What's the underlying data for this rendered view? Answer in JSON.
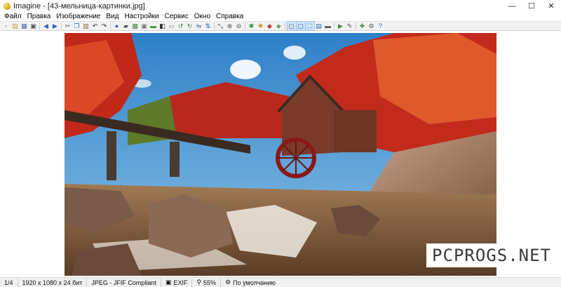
{
  "window": {
    "title": "Imagine - [43-мельница-картинки.jpg]",
    "minimize": "—",
    "maximize": "☐",
    "close": "✕"
  },
  "menu": {
    "items": [
      "Файл",
      "Правка",
      "Изображение",
      "Вид",
      "Настройки",
      "Сервис",
      "Окно",
      "Справка"
    ]
  },
  "toolbar": {
    "buttons": [
      {
        "icon": "new-icon",
        "glyph": "▫",
        "color": "#6a7fa8"
      },
      {
        "icon": "open-icon",
        "glyph": "▤",
        "color": "#c89a2a"
      },
      {
        "icon": "save-icon",
        "glyph": "▦",
        "color": "#4a6ea8"
      },
      {
        "icon": "print-icon",
        "glyph": "▣",
        "color": "#555555"
      },
      {
        "icon": "back-icon",
        "glyph": "◀",
        "color": "#2f62b8"
      },
      {
        "icon": "forward-icon",
        "glyph": "▶",
        "color": "#2f62b8"
      },
      {
        "icon": "cut-icon",
        "glyph": "✂",
        "color": "#555555"
      },
      {
        "icon": "copy-icon",
        "glyph": "❐",
        "color": "#4a6ea8"
      },
      {
        "icon": "paste-icon",
        "glyph": "▥",
        "color": "#8a6a3a"
      },
      {
        "icon": "undo-icon",
        "glyph": "↶",
        "color": "#333333"
      },
      {
        "icon": "redo-icon",
        "glyph": "↷",
        "color": "#333333"
      },
      {
        "icon": "info-icon",
        "glyph": "●",
        "color": "#2f62b8"
      },
      {
        "icon": "camera-icon",
        "glyph": "▰",
        "color": "#555555"
      },
      {
        "icon": "image-icon",
        "glyph": "▩",
        "color": "#3f8f3f"
      },
      {
        "icon": "printer-icon",
        "glyph": "▣",
        "color": "#777777"
      },
      {
        "icon": "scanner-icon",
        "glyph": "▬",
        "color": "#3f8f3f"
      },
      {
        "icon": "contrast-icon",
        "glyph": "◧",
        "color": "#222222"
      },
      {
        "icon": "crop-icon",
        "glyph": "▭",
        "color": "#777777"
      },
      {
        "icon": "rotate-left-icon",
        "glyph": "↺",
        "color": "#3f8f3f"
      },
      {
        "icon": "rotate-right-icon",
        "glyph": "↻",
        "color": "#3f8f3f"
      },
      {
        "icon": "flip-icon",
        "glyph": "⇋",
        "color": "#2f62b8"
      },
      {
        "icon": "mirror-icon",
        "glyph": "⇅",
        "color": "#2f62b8"
      },
      {
        "icon": "resize-icon",
        "glyph": "⤡",
        "color": "#555555"
      },
      {
        "icon": "zoom-in-icon",
        "glyph": "⊕",
        "color": "#555555"
      },
      {
        "icon": "zoom-out-icon",
        "glyph": "⊖",
        "color": "#555555"
      },
      {
        "icon": "effect-icon",
        "glyph": "✱",
        "color": "#3f8f3f"
      },
      {
        "icon": "brightness-icon",
        "glyph": "✺",
        "color": "#c89a2a"
      },
      {
        "icon": "color-icon",
        "glyph": "◆",
        "color": "#c03a3a"
      },
      {
        "icon": "filter-icon",
        "glyph": "◈",
        "color": "#3f8f3f"
      },
      {
        "icon": "fit-icon",
        "glyph": "◻",
        "color": "#555555"
      },
      {
        "icon": "actual-size-icon",
        "glyph": "▢",
        "color": "#2f62b8"
      },
      {
        "icon": "fullscreen-icon",
        "glyph": "⛶",
        "color": "#2f62b8"
      },
      {
        "icon": "window-icon",
        "glyph": "▤",
        "color": "#2f62b8"
      },
      {
        "icon": "monitor-icon",
        "glyph": "▬",
        "color": "#555555"
      },
      {
        "icon": "slideshow-icon",
        "glyph": "▶",
        "color": "#3f8f3f"
      },
      {
        "icon": "tools-icon",
        "glyph": "✎",
        "color": "#555555"
      },
      {
        "icon": "plugin-icon",
        "glyph": "✚",
        "color": "#3f8f3f"
      },
      {
        "icon": "settings-icon",
        "glyph": "⚙",
        "color": "#555555"
      },
      {
        "icon": "help-icon",
        "glyph": "?",
        "color": "#2f62b8"
      }
    ]
  },
  "image": {
    "description_icon": "photo-canvas"
  },
  "watermark": {
    "text": "PCPROGS.NET"
  },
  "status": {
    "index": "1/4",
    "dimensions": "1920 x 1080 x 24 бит",
    "format": "JPEG - JFIF Compliant",
    "exif": "EXIF",
    "zoom": "55%",
    "mode": "По умолчанию"
  },
  "colors": {
    "sky": "#3a8fd1",
    "foliage": "#c8301e",
    "water": "#8a6a4a"
  }
}
